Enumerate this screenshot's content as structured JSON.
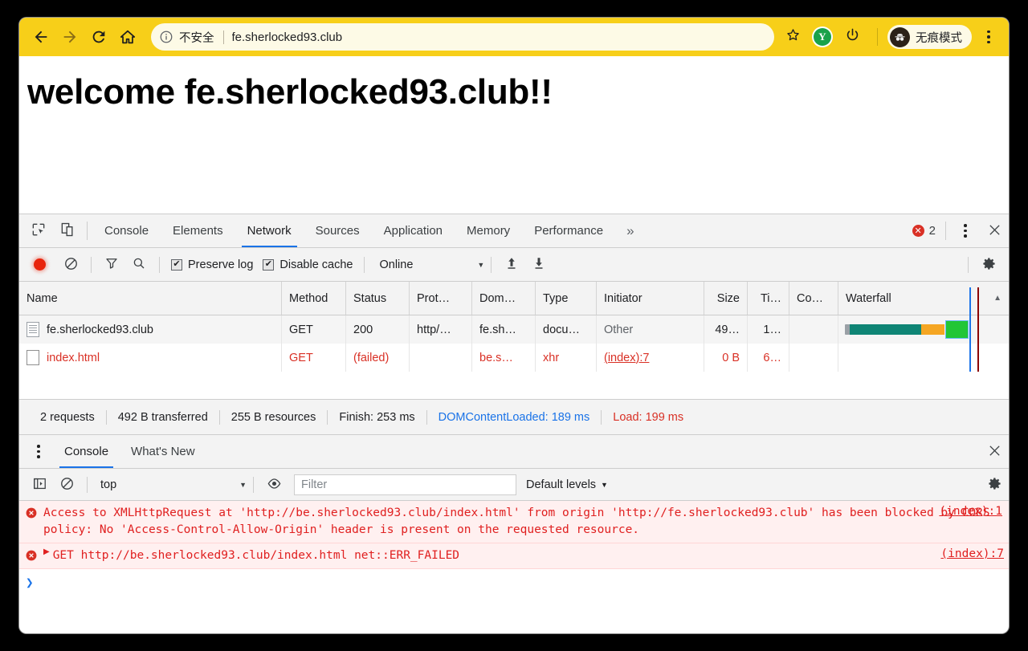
{
  "browser": {
    "back_icon": "back-arrow-icon",
    "forward_icon": "forward-arrow-icon",
    "reload_icon": "reload-icon",
    "home_icon": "home-icon",
    "security_label": "不安全",
    "url": "fe.sherlocked93.club",
    "bookmark_icon": "star-icon",
    "extension_label": "Y",
    "power_icon": "power-icon",
    "incognito_label": "无痕模式",
    "menu_icon": "kebab-menu-icon",
    "toolbar_color": "#f7cf19"
  },
  "page": {
    "heading": "welcome fe.sherlocked93.club!!"
  },
  "devtools": {
    "inspect_icon": "inspect-element-icon",
    "device_icon": "device-toolbar-icon",
    "tabs": [
      {
        "label": "Console",
        "active": false
      },
      {
        "label": "Elements",
        "active": false
      },
      {
        "label": "Network",
        "active": true
      },
      {
        "label": "Sources",
        "active": false
      },
      {
        "label": "Application",
        "active": false
      },
      {
        "label": "Memory",
        "active": false
      },
      {
        "label": "Performance",
        "active": false
      }
    ],
    "more_tabs_icon": "chevron-double-right-icon",
    "error_count": "2",
    "error_badge_icon": "error-circle-icon",
    "settings_menu_icon": "kebab-menu-icon",
    "close_icon": "close-icon",
    "accent_color": "#1a73e8"
  },
  "network_toolbar": {
    "record_icon": "record-button",
    "clear_icon": "clear-icon",
    "filter_icon": "filter-icon",
    "search_icon": "search-icon",
    "preserve_log_label": "Preserve log",
    "preserve_log_checked": true,
    "disable_cache_label": "Disable cache",
    "disable_cache_checked": true,
    "throttling_value": "Online",
    "throttling_caret": "▼",
    "import_icon": "upload-har-icon",
    "export_icon": "download-har-icon",
    "settings_icon": "gear-icon"
  },
  "network_table": {
    "columns": [
      "Name",
      "Method",
      "Status",
      "Prot…",
      "Dom…",
      "Type",
      "Initiator",
      "Size",
      "Ti…",
      "Co…",
      "Waterfall"
    ],
    "sort_indicator": "▲",
    "rows": [
      {
        "name": "fe.sherlocked93.club",
        "method": "GET",
        "status": "200",
        "protocol": "http/…",
        "domain": "fe.sh…",
        "type": "docu…",
        "initiator": "Other",
        "size": "49…",
        "time": "1…",
        "connection": "",
        "failed": false,
        "icon": "document-icon"
      },
      {
        "name": "index.html",
        "method": "GET",
        "status": "(failed)",
        "protocol": "",
        "domain": "be.s…",
        "type": "xhr",
        "initiator": "(index):7",
        "size": "0 B",
        "time": "6…",
        "connection": "",
        "failed": true,
        "icon": "blank-file-icon"
      }
    ]
  },
  "summary": {
    "requests": "2 requests",
    "transferred": "492 B transferred",
    "resources": "255 B resources",
    "finish": "Finish: 253 ms",
    "dom_content_loaded": "DOMContentLoaded: 189 ms",
    "load": "Load: 199 ms",
    "dcl_color": "#1a73e8",
    "load_color": "#d93025"
  },
  "drawer": {
    "menu_icon": "kebab-menu-icon",
    "tabs": [
      {
        "label": "Console",
        "active": true
      },
      {
        "label": "What's New",
        "active": false
      }
    ],
    "close_icon": "close-icon"
  },
  "console_toolbar": {
    "sidebar_icon": "console-sidebar-icon",
    "clear_icon": "clear-console-icon",
    "context": "top",
    "context_caret": "▼",
    "live_expression_icon": "eye-icon",
    "filter_placeholder": "Filter",
    "filter_value": "",
    "levels_label": "Default levels",
    "levels_caret": "▼",
    "settings_icon": "gear-icon"
  },
  "console_messages": [
    {
      "icon": "error-circle-icon",
      "text": "Access to XMLHttpRequest at 'http://be.sherlocked93.club/index.html' from origin 'http://fe.sherlocked93.club' has been blocked by CORS policy: No 'Access-Control-Allow-Origin' header is present on the requested resource.",
      "source": "(index):1"
    },
    {
      "icon": "error-circle-icon",
      "expand_triangle": "▶",
      "text": "GET http://be.sherlocked93.club/index.html net::ERR_FAILED",
      "source": "(index):7"
    }
  ],
  "console_prompt": {
    "caret": "❯"
  }
}
